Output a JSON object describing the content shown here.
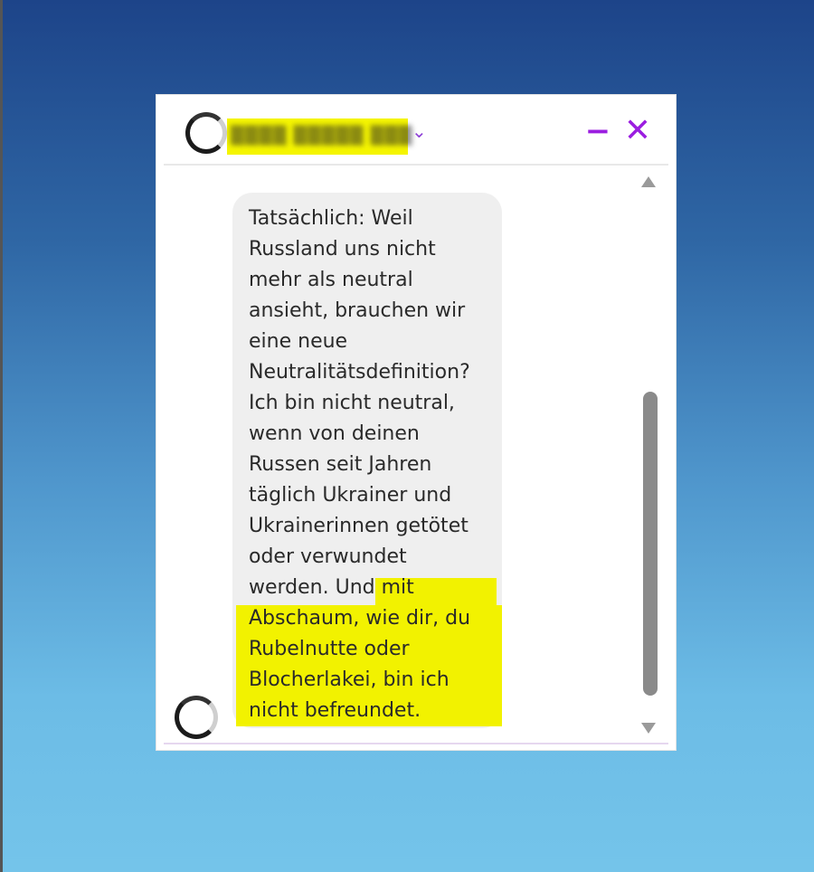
{
  "header": {
    "contact_name": "▒▒▒▒ ▒▒▒▒▒ ▒▒▒",
    "dropdown_icon": "chevron-down-icon",
    "minimize_label": "−",
    "close_label": "✕",
    "accent_color": "#9b1ee0",
    "name_highlight_color": "#f5f500"
  },
  "message": {
    "lines": [
      "Tatsächlich: Weil",
      "Russland uns nicht",
      "mehr als neutral",
      "ansieht, brauchen wir",
      "eine neue",
      "Neutralitätsdefinition?",
      "Ich bin nicht neutral,",
      "wenn von deinen",
      "Russen seit Jahren",
      "täglich Ukrainer und",
      "Ukrainerinnen getötet",
      "oder verwundet",
      "werden. Und mit",
      "Abschaum, wie dir, du",
      "Rubelnutte oder",
      "Blocherlakei, bin ich",
      "nicht befreundet."
    ],
    "highlighted_text": "mit Abschaum, wie dir, du Rubelnutte oder Blocherlakei, bin ich nicht befreundet.",
    "highlight_color": "#f2f200",
    "bubble_color": "#efefef"
  },
  "scrollbar": {
    "up_icon": "triangle-up-icon",
    "down_icon": "triangle-down-icon"
  }
}
